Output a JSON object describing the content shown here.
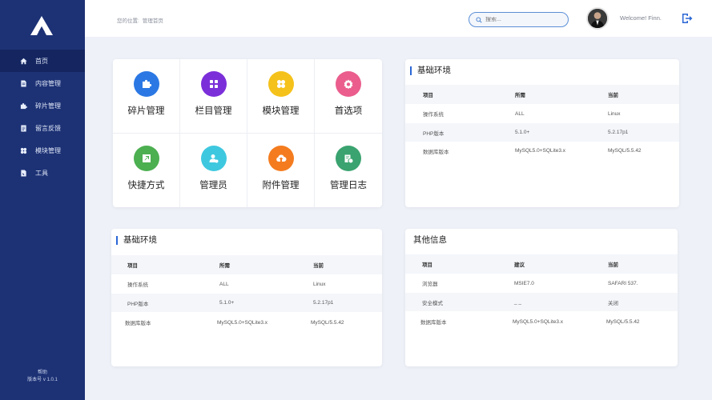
{
  "sidebar": {
    "items": [
      {
        "label": "首页",
        "icon": "home-icon"
      },
      {
        "label": "内容管理",
        "icon": "document-icon"
      },
      {
        "label": "碎片管理",
        "icon": "puzzle-icon"
      },
      {
        "label": "留言反馈",
        "icon": "message-icon"
      },
      {
        "label": "模块管理",
        "icon": "modules-icon"
      },
      {
        "label": "工具",
        "icon": "tool-icon"
      }
    ],
    "footer_help": "帮助",
    "footer_version": "版本号 v 1.0.1"
  },
  "header": {
    "crumb_prefix": "您的位置:",
    "crumb_page": "管理首页",
    "search_placeholder": "搜索...",
    "welcome": "Welcome! Finn."
  },
  "tiles": [
    {
      "label": "碎片管理",
      "color": "#2b78e4",
      "icon": "puzzle-icon"
    },
    {
      "label": "栏目管理",
      "color": "#7b2fd9",
      "icon": "grid-icon"
    },
    {
      "label": "模块管理",
      "color": "#f5c21b",
      "icon": "modules-icon"
    },
    {
      "label": "首选项",
      "color": "#ea5d8c",
      "icon": "settings-icon"
    },
    {
      "label": "快捷方式",
      "color": "#4caf50",
      "icon": "shortcut-icon"
    },
    {
      "label": "管理员",
      "color": "#3ec8df",
      "icon": "admin-icon"
    },
    {
      "label": "附件管理",
      "color": "#f47c1f",
      "icon": "cloud-upload-icon"
    },
    {
      "label": "管理日志",
      "color": "#3aa36f",
      "icon": "log-icon"
    }
  ],
  "env_top": {
    "title": "基础环境",
    "headers": [
      "项目",
      "所需",
      "当前"
    ],
    "rows": [
      [
        "操作系统",
        "ALL",
        "Linux"
      ],
      [
        "PHP版本",
        "5.1.0+",
        "5.2.17p1"
      ],
      [
        "数据库版本",
        "MySQL5.0+SQLite3.x",
        "MySQL/5.5.42"
      ]
    ]
  },
  "env_bottom": {
    "title": "基础环境",
    "headers": [
      "项目",
      "所需",
      "当前"
    ],
    "rows": [
      [
        "操作系统",
        "ALL",
        "Linux"
      ],
      [
        "PHP版本",
        "5.1.0+",
        "5.2.17p1"
      ],
      [
        "数据库版本",
        "MySQL5.0+SQLite3.x",
        "MySQL/5.5.42"
      ]
    ]
  },
  "other": {
    "title": "其他信息",
    "headers": [
      "项目",
      "建议",
      "当前"
    ],
    "rows": [
      [
        "浏览器",
        "MSIE7.0",
        "SAFARI 537."
      ],
      [
        "安全模式",
        "_ _",
        "关闭"
      ],
      [
        "数据库版本",
        "MySQL5.0+SQLite3.x",
        "MySQL/5.5.42"
      ]
    ]
  },
  "colors": {
    "sidebar": "#1d3275",
    "sidebar_active": "#142560",
    "accent": "#2b67d6"
  }
}
